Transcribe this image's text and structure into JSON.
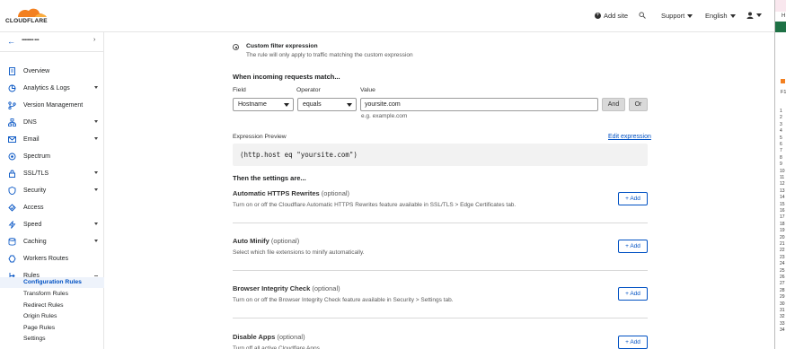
{
  "brand": {
    "name": "CLOUDFLARE",
    "accent": "#f38020",
    "link_color": "#0051c3"
  },
  "topbar": {
    "add_site": "Add site",
    "support": "Support",
    "language": "English"
  },
  "sidebar": {
    "account_name": "▪▪▪▪▪▪▪▪  ▪▪▪",
    "items": [
      {
        "label": "Overview",
        "icon": "document-icon",
        "has_chevron": false
      },
      {
        "label": "Analytics & Logs",
        "icon": "chart-icon",
        "has_chevron": true
      },
      {
        "label": "Version Management",
        "icon": "branch-icon",
        "has_chevron": false
      },
      {
        "label": "DNS",
        "icon": "network-icon",
        "has_chevron": true
      },
      {
        "label": "Email",
        "icon": "email-icon",
        "has_chevron": true
      },
      {
        "label": "Spectrum",
        "icon": "spectrum-icon",
        "has_chevron": false
      },
      {
        "label": "SSL/TLS",
        "icon": "lock-icon",
        "has_chevron": true
      },
      {
        "label": "Security",
        "icon": "shield-icon",
        "has_chevron": true
      },
      {
        "label": "Access",
        "icon": "access-icon",
        "has_chevron": false
      },
      {
        "label": "Speed",
        "icon": "bolt-icon",
        "has_chevron": true
      },
      {
        "label": "Caching",
        "icon": "caching-icon",
        "has_chevron": true
      },
      {
        "label": "Workers Routes",
        "icon": "workers-icon",
        "has_chevron": false
      },
      {
        "label": "Rules",
        "icon": "rules-icon",
        "has_chevron": true
      }
    ],
    "rules_sub": [
      {
        "label": "Configuration Rules",
        "active": true
      },
      {
        "label": "Transform Rules",
        "active": false
      },
      {
        "label": "Redirect Rules",
        "active": false
      },
      {
        "label": "Origin Rules",
        "active": false
      },
      {
        "label": "Page Rules",
        "active": false
      },
      {
        "label": "Settings",
        "active": false
      }
    ]
  },
  "filter": {
    "radio_label": "Custom filter expression",
    "radio_desc": "The rule will only apply to traffic matching the custom expression"
  },
  "match": {
    "heading": "When incoming requests match...",
    "field_label": "Field",
    "operator_label": "Operator",
    "value_label": "Value",
    "field_value": "Hostname",
    "operator_value": "equals",
    "value_value": "yoursite.com",
    "hint": "e.g. example.com",
    "and_label": "And",
    "or_label": "Or"
  },
  "expression": {
    "label": "Expression Preview",
    "edit_link": "Edit expression",
    "code": "(http.host eq \"yoursite.com\")"
  },
  "settings": {
    "heading": "Then the settings are...",
    "add_label": "+ Add",
    "items": [
      {
        "title": "Automatic HTTPS Rewrites",
        "optional": "(optional)",
        "desc": "Turn on or off the Cloudflare Automatic HTTPS Rewrites feature available in SSL/TLS > Edge Certificates tab."
      },
      {
        "title": "Auto Minify",
        "optional": "(optional)",
        "desc": "Select which file extensions to minify automatically."
      },
      {
        "title": "Browser Integrity Check",
        "optional": "(optional)",
        "desc": "Turn on or off the Browser Integrity Check feature available in Security > Settings tab."
      },
      {
        "title": "Disable Apps",
        "optional": "(optional)",
        "desc": "Turn off all active Cloudflare Apps."
      }
    ]
  },
  "right_panel": {
    "top_letter": "H",
    "cell_ref": "F1",
    "rows": [
      "1",
      "2",
      "3",
      "4",
      "5",
      "6",
      "7",
      "8",
      "9",
      "10",
      "11",
      "12",
      "13",
      "14",
      "15",
      "16",
      "17",
      "18",
      "19",
      "20",
      "21",
      "22",
      "23",
      "24",
      "25",
      "26",
      "27",
      "28",
      "29",
      "30",
      "31",
      "32",
      "33",
      "34"
    ]
  }
}
